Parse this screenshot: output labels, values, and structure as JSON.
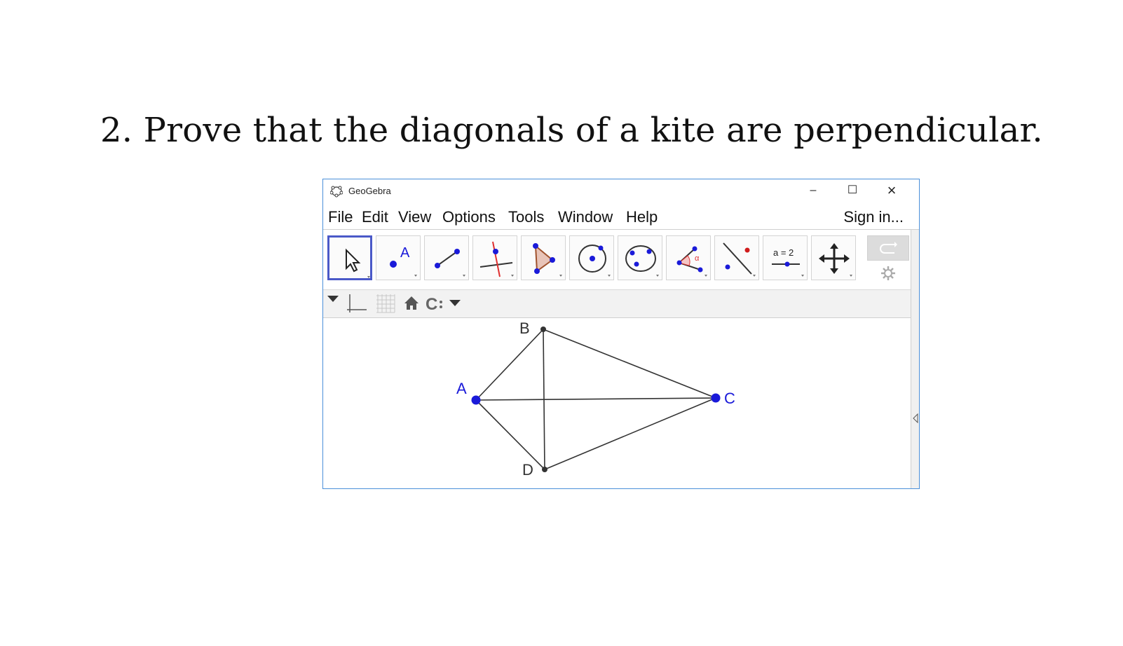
{
  "problem": {
    "text": "2. Prove that the diagonals of a kite are perpendicular."
  },
  "window": {
    "title": "GeoGebra",
    "controls": {
      "minimize": "–",
      "maximize": "☐",
      "close": "×"
    }
  },
  "menu": {
    "items": [
      "File",
      "Edit",
      "View",
      "Options",
      "Tools",
      "Window",
      "Help"
    ],
    "signin": "Sign in..."
  },
  "toolbar": {
    "tools": [
      {
        "name": "move-tool-button",
        "icon": "cursor-arrow-icon"
      },
      {
        "name": "point-tool-button",
        "icon": "point-A-icon",
        "label": "A"
      },
      {
        "name": "line-tool-button",
        "icon": "segment-icon"
      },
      {
        "name": "perpendicular-tool-button",
        "icon": "perpendicular-line-icon"
      },
      {
        "name": "polygon-tool-button",
        "icon": "triangle-polygon-icon"
      },
      {
        "name": "circle-tool-button",
        "icon": "circle-center-icon"
      },
      {
        "name": "conic-tool-button",
        "icon": "conic-ellipse-icon"
      },
      {
        "name": "angle-tool-button",
        "icon": "angle-alpha-icon",
        "label": "α"
      },
      {
        "name": "reflect-tool-button",
        "icon": "reflect-line-icon"
      },
      {
        "name": "slider-tool-button",
        "icon": "slider-icon",
        "label": "a = 2"
      },
      {
        "name": "move-graphics-tool-button",
        "icon": "four-arrows-icon"
      }
    ]
  },
  "stylebar": {
    "items": [
      "toggle-style-triangle-icon",
      "axes-icon",
      "grid-icon",
      "home-icon",
      "color-c-icon",
      "dropdown-triangle-icon"
    ]
  },
  "graphics": {
    "points": [
      {
        "label": "A",
        "color": "#1a1ad9"
      },
      {
        "label": "B",
        "color": "#333333"
      },
      {
        "label": "C",
        "color": "#1a1ad9"
      },
      {
        "label": "D",
        "color": "#333333"
      }
    ]
  },
  "colors": {
    "accent": "#4a59c8",
    "point_blue": "#1a1ad9",
    "window_border": "#4a8fd9"
  }
}
